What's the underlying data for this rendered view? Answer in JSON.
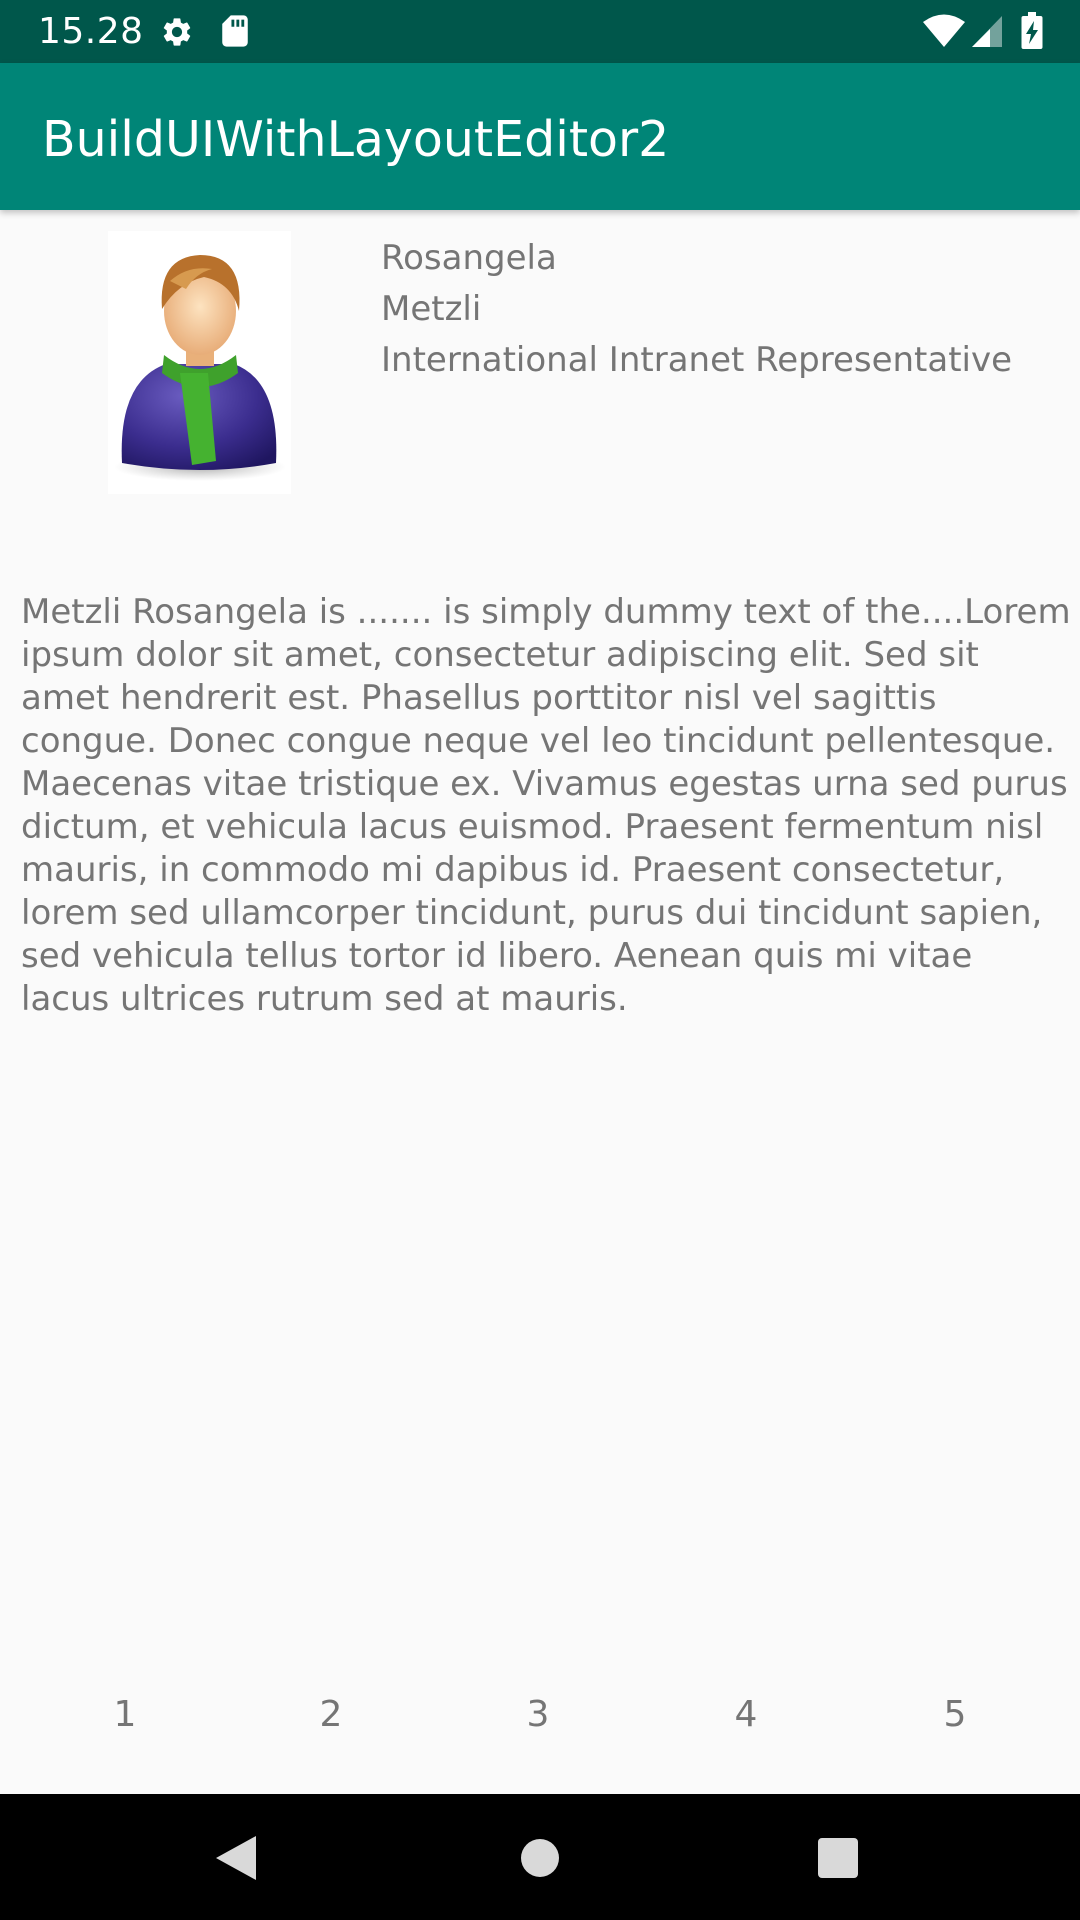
{
  "status_bar": {
    "time": "15.28",
    "icons": [
      "gear-icon",
      "sd-card-icon",
      "wifi-icon",
      "cell-signal-icon",
      "battery-charging-icon"
    ],
    "background": "#00574b"
  },
  "app_bar": {
    "title": "BuildUIWithLayoutEditor2",
    "background": "#008577"
  },
  "profile": {
    "avatar_icon": "user-avatar-icon",
    "first_name": "Rosangela",
    "last_name": "Metzli",
    "job_title": "International Intranet Representative"
  },
  "description": "Metzli Rosangela is ....... is simply dummy text of the....Lorem ipsum dolor sit amet, consectetur adipiscing elit. Sed sit amet hendrerit est. Phasellus porttitor nisl vel sagittis congue. Donec congue neque vel leo tincidunt pellentesque. Maecenas vitae tristique ex. Vivamus egestas urna sed purus dictum, et vehicula lacus euismod. Praesent fermentum nisl mauris, in commodo mi dapibus id. Praesent consectetur, lorem sed ullamcorper tincidunt, purus dui tincidunt sapien, sed vehicula tellus tortor id libero. Aenean quis mi vitae lacus ultrices rutrum sed at mauris.",
  "pager": {
    "items": [
      "1",
      "2",
      "3",
      "4",
      "5"
    ]
  },
  "nav_bar": {
    "icons": [
      "back-icon",
      "home-icon",
      "recents-icon"
    ]
  }
}
